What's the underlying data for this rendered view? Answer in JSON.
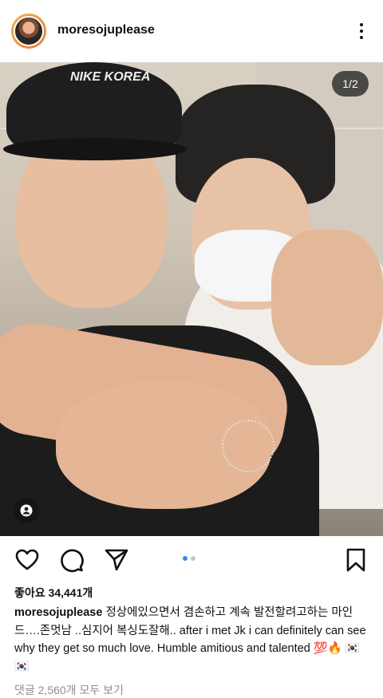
{
  "post": {
    "username": "moresojuplease",
    "page_indicator": "1/2",
    "photo_brand_text": "NIKE KOREA",
    "likes_text": "좋아요 34,441개",
    "caption_username": "moresojuplease",
    "caption_text": "정상에있으면서 겸손하고 계속 발전할려고하는 마인드….존멋남 ..심지어 복싱도잘해.. after i met Jk i can definitely can see why they get so much love. Humble amitious and talented 💯🔥 🇰🇷 🇰🇷",
    "comments_link": "댓글 2,560개 모두 보기"
  },
  "carousel": {
    "total": 2,
    "current": 1
  },
  "icons": {
    "more": "more-vertical-icon",
    "like": "heart-icon",
    "comment": "comment-icon",
    "share": "send-icon",
    "save": "bookmark-icon",
    "tags": "user-tag-icon"
  },
  "colors": {
    "active_dot": "#2e8cf0",
    "inactive_dot": "#c7c7c7",
    "muted_text": "#8e8e8e"
  }
}
